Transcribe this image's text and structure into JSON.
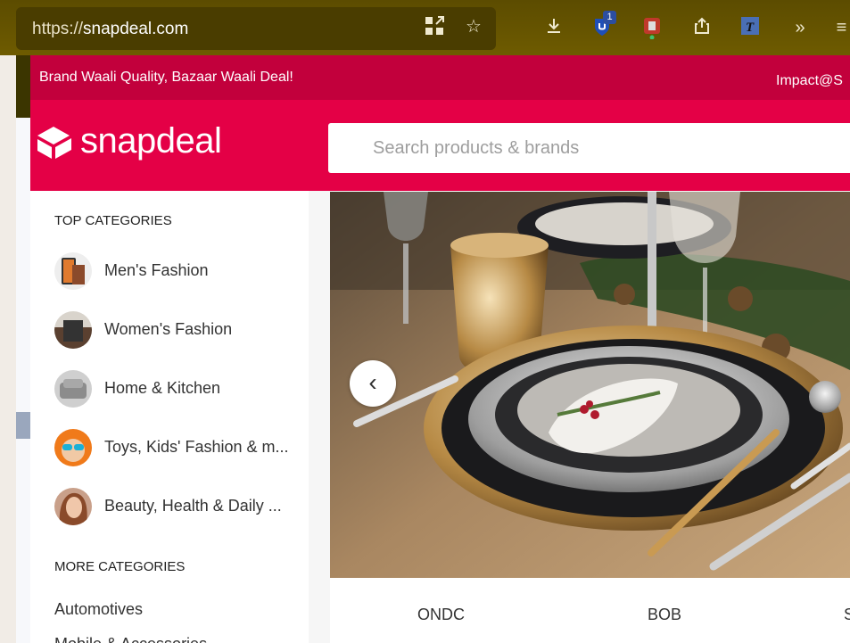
{
  "browser": {
    "url_prefix": "https://",
    "url_domain": "snapdeal.com",
    "extension_badge_count": "1",
    "icons": [
      "qr-code-icon",
      "bookmark-star-icon",
      "download-icon",
      "ublock-shield-icon",
      "extension-red-icon",
      "share-icon",
      "translate-extension-icon",
      "overflow-chevrons-icon",
      "menu-icon"
    ]
  },
  "promo": {
    "left_text": "Brand Waali Quality, Bazaar Waali Deal!",
    "right_text": "Impact@S"
  },
  "header": {
    "logo_text": "snapdeal",
    "search_placeholder": "Search products & brands"
  },
  "sidebar": {
    "top_title": "TOP CATEGORIES",
    "top_categories": [
      {
        "label": "Men's Fashion"
      },
      {
        "label": "Women's Fashion"
      },
      {
        "label": "Home & Kitchen"
      },
      {
        "label": "Toys, Kids' Fashion & m..."
      },
      {
        "label": "Beauty, Health & Daily ..."
      }
    ],
    "more_title": "MORE CATEGORIES",
    "more_categories": [
      "Automotives",
      "Mobile & Accessories"
    ]
  },
  "banner": {
    "tabs": [
      "ONDC",
      "BOB",
      "S"
    ]
  },
  "colors": {
    "brand_red": "#e40046",
    "promo_red": "#c2003c",
    "toolbar_olive": "#6b5a00"
  }
}
